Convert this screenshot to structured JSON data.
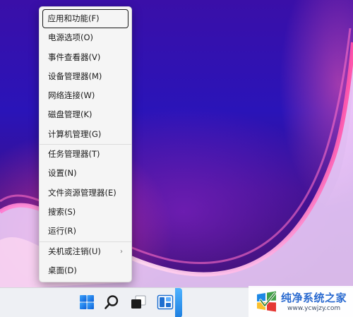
{
  "context_menu": {
    "items": [
      {
        "label": "应用和功能(F)",
        "focused": true
      },
      {
        "label": "电源选项(O)"
      },
      {
        "label": "事件查看器(V)"
      },
      {
        "label": "设备管理器(M)"
      },
      {
        "label": "网络连接(W)"
      },
      {
        "label": "磁盘管理(K)"
      },
      {
        "label": "计算机管理(G)"
      },
      {
        "label": "任务管理器(T)"
      },
      {
        "label": "设置(N)"
      },
      {
        "label": "文件资源管理器(E)"
      },
      {
        "label": "搜索(S)"
      },
      {
        "label": "运行(R)"
      },
      {
        "label": "关机或注销(U)",
        "has_submenu": true
      },
      {
        "label": "桌面(D)"
      }
    ],
    "submenu_arrow": "›"
  },
  "taskbar": {
    "icons": [
      "windows-start-icon",
      "search-icon",
      "task-view-icon",
      "widgets-icon"
    ]
  },
  "watermark": {
    "title": "纯净系统之家",
    "url": "www.ycwjzy.com"
  },
  "colors": {
    "menu_bg": "#f5f5f5",
    "taskbar_bg": "#eef0f4",
    "windows_blue": "#1d6fe0",
    "watermark_blue": "#2a6ad0"
  }
}
